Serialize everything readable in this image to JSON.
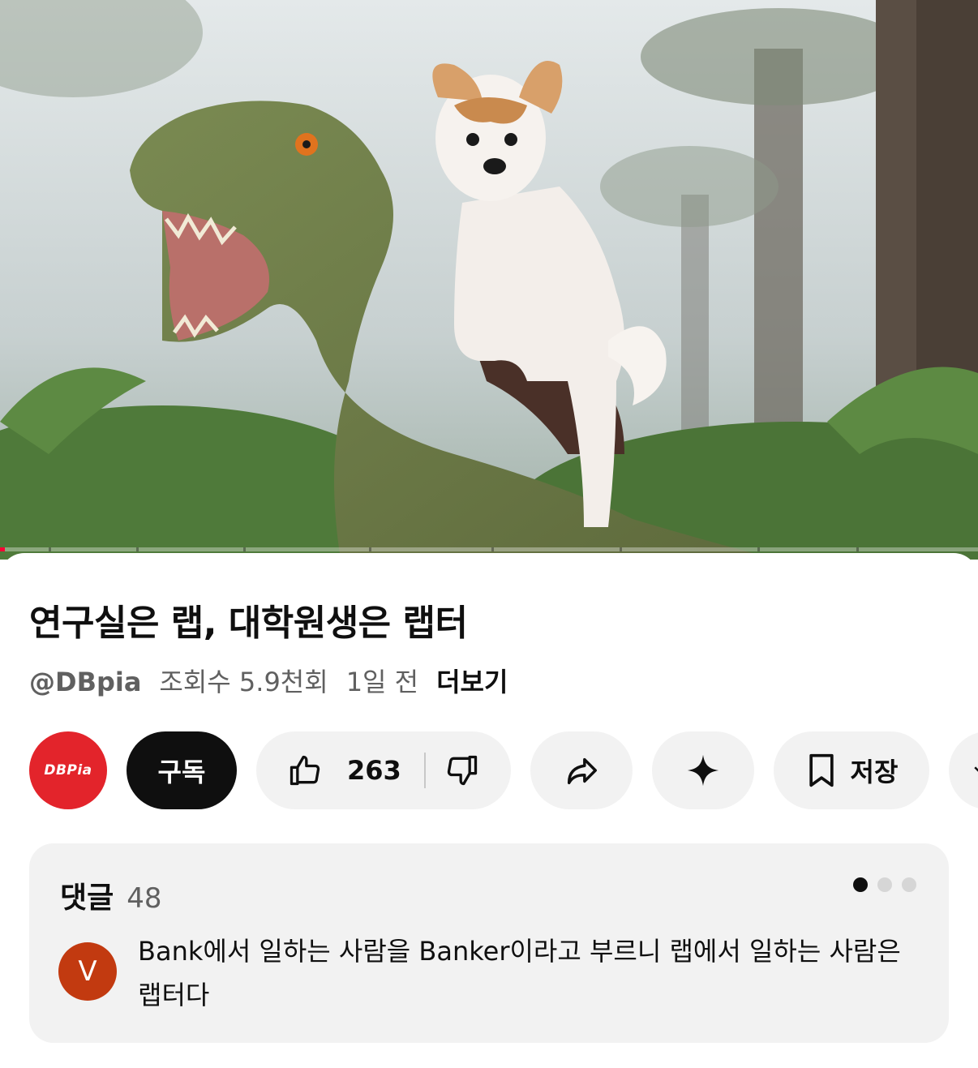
{
  "video": {
    "progress_fraction": 0.005
  },
  "title": "연구실은 랩, 대학원생은 랩터",
  "meta": {
    "channel": "@DBpia",
    "views": "조회수 5.9천회",
    "age": "1일 전",
    "more": "더보기"
  },
  "actions": {
    "channel_avatar_text": "DBPia",
    "subscribe_label": "구독",
    "like_count": "263",
    "save_label": "저장"
  },
  "comments": {
    "label": "댓글",
    "count": "48",
    "pager_total": 3,
    "pager_active": 0,
    "top_comment": {
      "avatar_letter": "V",
      "text": "Bank에서 일하는 사람을 Banker이라고 부르니 랩에서 일하는 사람은 랩터다"
    }
  },
  "icons": {
    "like": "thumbs-up-icon",
    "dislike": "thumbs-down-icon",
    "share": "share-arrow-icon",
    "ai": "sparkle-icon",
    "save": "bookmark-icon",
    "more": "chevron-down-icon"
  },
  "colors": {
    "progress": "#ff0033",
    "channel_avatar": "#e3242b",
    "commenter_avatar": "#c23a10",
    "subscribe_bg": "#0f0f0f",
    "pill_bg": "#f2f2f2"
  }
}
